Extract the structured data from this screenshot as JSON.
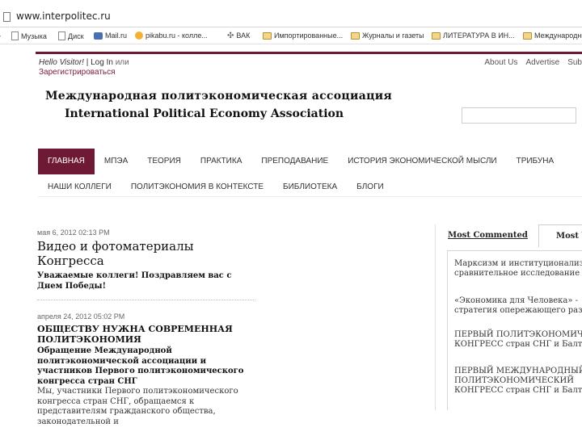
{
  "browser": {
    "url": "www.interpolitec.ru",
    "bookmarks": [
      {
        "label": "Музыка",
        "icon": "doc-icon"
      },
      {
        "label": "Диск",
        "icon": "doc-icon"
      },
      {
        "label": "Mail.ru",
        "icon": "mail-icon"
      },
      {
        "label": "pikabu.ru - колле...",
        "icon": "pikabu-icon"
      },
      {
        "label": "ВАК",
        "icon": "vak-icon"
      },
      {
        "label": "Импортированные...",
        "icon": "folder-icon"
      },
      {
        "label": "Журналы и газеты",
        "icon": "folder-icon"
      },
      {
        "label": "ЛИТЕРАТУРА В ИН...",
        "icon": "folder-icon"
      },
      {
        "label": "Международные...",
        "icon": "folder-icon"
      }
    ]
  },
  "header": {
    "welcome": "Hello Visitor!",
    "login": "Log In",
    "or": "или",
    "register": "Зарегистрироваться",
    "links": [
      "About Us",
      "Advertise",
      "Sub"
    ]
  },
  "logo": {
    "ru": "Международная политэкономическая ассоциация",
    "en": "International Political Economy Association"
  },
  "nav": {
    "main": [
      "Главная",
      "МПЭА",
      "Теория",
      "Практика",
      "Преподавание",
      "История экономической мысли",
      "Трибуна"
    ],
    "sub": [
      "Наши коллеги",
      "Политэкономия в контексте",
      "Библиотека",
      "Блоги"
    ]
  },
  "posts": [
    {
      "date": "мая 6, 2012 02:13 PM",
      "title": "Видео и фотоматериалы Конгресса",
      "excerpt": "Уважаемые коллеги! Поздравляем вас с Днем Победы!"
    },
    {
      "date": "апреля 24, 2012 05:02 PM",
      "title": "ОБЩЕСТВУ НУЖНА СОВРЕМЕННАЯ ПОЛИТЭКОНОМИЯ",
      "excerpt": "Обращение Международной политэкономической ассоциации и участников Первого политэкономического конгресса стран СНГ",
      "body": "Мы, участники Первого политэкономического конгресса стран СНГ, обращаемся к представителям гражданского общества, законодательной и"
    }
  ],
  "sidebar": {
    "tabs": [
      "Most Commented",
      "Most Viewed"
    ],
    "items": [
      [
        "Марксизм и институционализм",
        "сравнительное исследование"
      ],
      [
        "«Экономика для Человека» -",
        "стратегия опережающего развития"
      ],
      [
        "ПЕРВЫЙ ПОЛИТЭКОНОМИЧЕСКИЙ",
        "КОНГРЕСС стран СНГ и Балтии"
      ],
      [
        "ПЕРВЫЙ МЕЖДУНАРОДНЫЙ",
        "ПОЛИТЭКОНОМИЧЕСКИЙ",
        "КОНГРЕСС стран СНГ и Балтии"
      ]
    ]
  },
  "colors": {
    "accent": "#6f1a35"
  }
}
